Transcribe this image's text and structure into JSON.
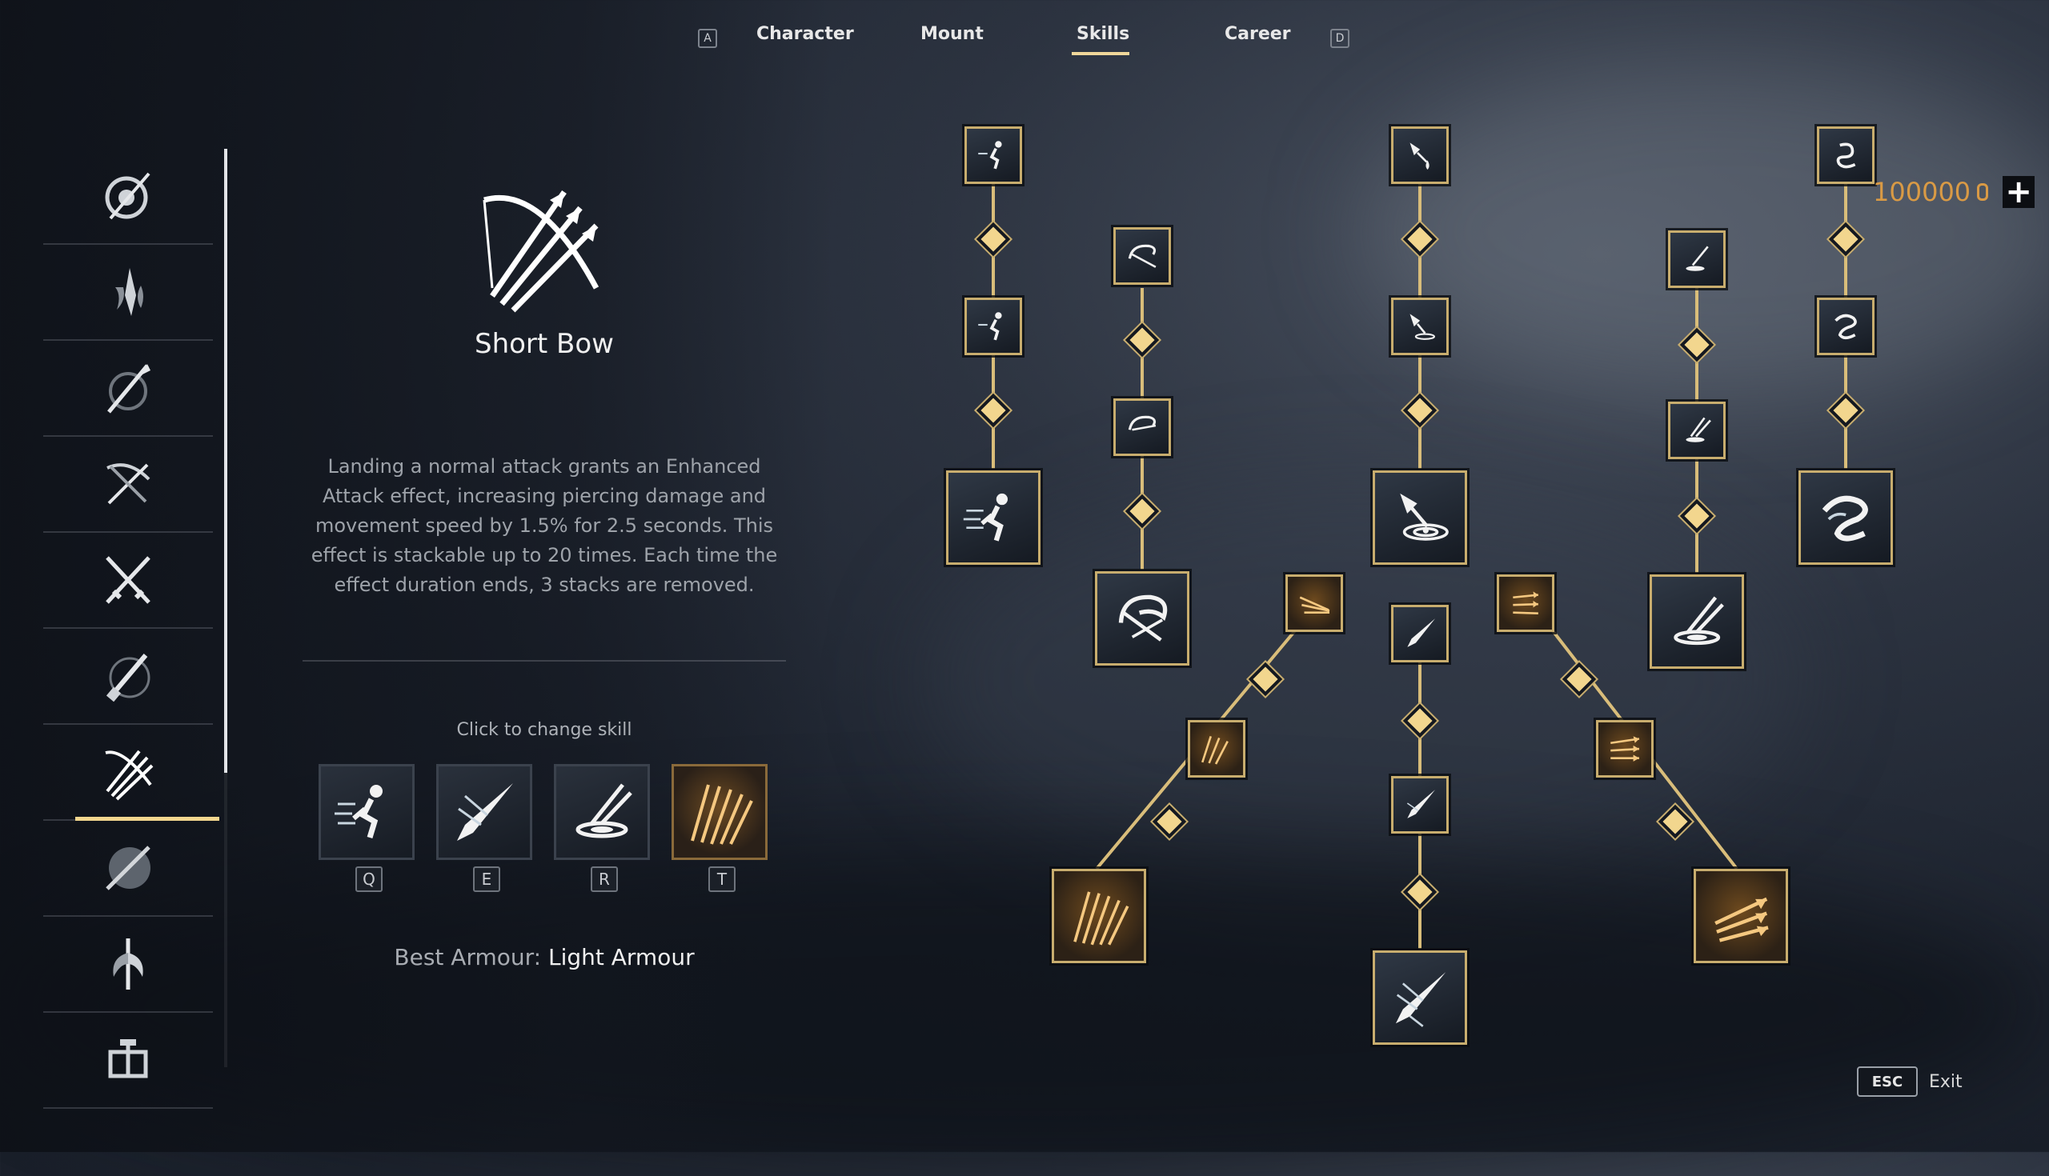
{
  "nav": {
    "left_key": "A",
    "right_key": "D",
    "tabs": [
      {
        "label": "Character"
      },
      {
        "label": "Mount"
      },
      {
        "label": "Skills"
      },
      {
        "label": "Career"
      }
    ],
    "active_tab": "Skills"
  },
  "sidebar": {
    "items": [
      {
        "icon": "shield-spear-icon"
      },
      {
        "icon": "flame-blade-icon"
      },
      {
        "icon": "spear-icon"
      },
      {
        "icon": "crossbow-icon"
      },
      {
        "icon": "crossed-swords-icon"
      },
      {
        "icon": "musket-icon"
      },
      {
        "icon": "short-bow-icon",
        "active": true
      },
      {
        "icon": "sword-shield-icon"
      },
      {
        "icon": "halberd-icon"
      },
      {
        "icon": "cannon-icon"
      }
    ]
  },
  "detail": {
    "skill_name": "Short Bow",
    "description": "Landing a normal attack grants an Enhanced Attack effect, increasing piercing damage and movement speed by 1.5% for 2.5 seconds. This effect is stackable up to 20 times. Each time the effect duration ends, 3 stacks are removed.",
    "change_label": "Click to change skill",
    "slots": [
      {
        "key": "Q",
        "icon": "sprint-icon"
      },
      {
        "key": "E",
        "icon": "piercing-arrow-icon"
      },
      {
        "key": "R",
        "icon": "arrow-vortex-icon"
      },
      {
        "key": "T",
        "icon": "arrow-volley-icon"
      }
    ],
    "best_armour_label": "Best Armour:",
    "best_armour_value": "Light Armour"
  },
  "currency": {
    "amount": "100000"
  },
  "exit": {
    "key": "ESC",
    "label": "Exit"
  },
  "colors": {
    "gold": "#f2d68e",
    "frame": "#c8ad6e",
    "currency": "#d99a45"
  }
}
